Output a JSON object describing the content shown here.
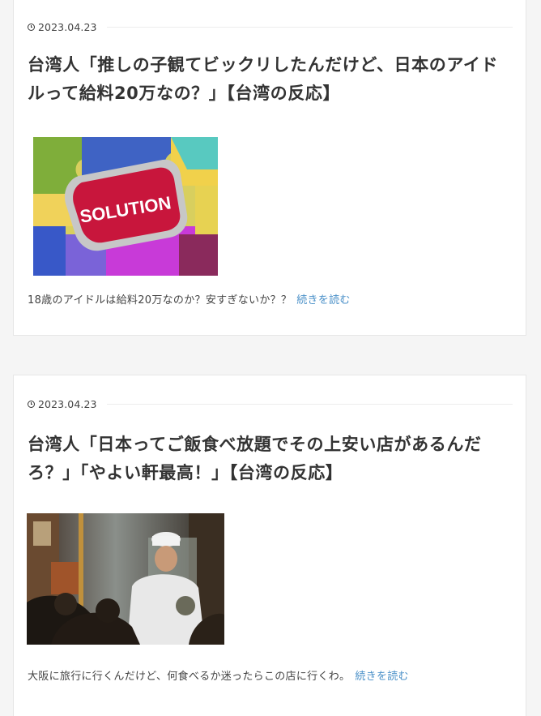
{
  "posts": [
    {
      "date": "2023.04.23",
      "title": "台湾人「推しの子観てビックリしたんだけど、日本のアイドルって給料20万なの？」【台湾の反応】",
      "image_text": "SOLUTION",
      "excerpt": "18歳のアイドルは給料20万なのか？安すぎないか？？",
      "more_label": "続きを読む"
    },
    {
      "date": "2023.04.23",
      "title": "台湾人「日本ってご飯食べ放題でその上安い店があるんだろ？」「やよい軒最高！」【台湾の反応】",
      "excerpt": "大阪に旅行に行くんだけど、何食べるか迷ったらこの店に行くわ。",
      "more_label": "続きを読む"
    }
  ],
  "colors": {
    "link": "#4a90c8",
    "text": "#333333",
    "background": "#f5f5f5"
  }
}
